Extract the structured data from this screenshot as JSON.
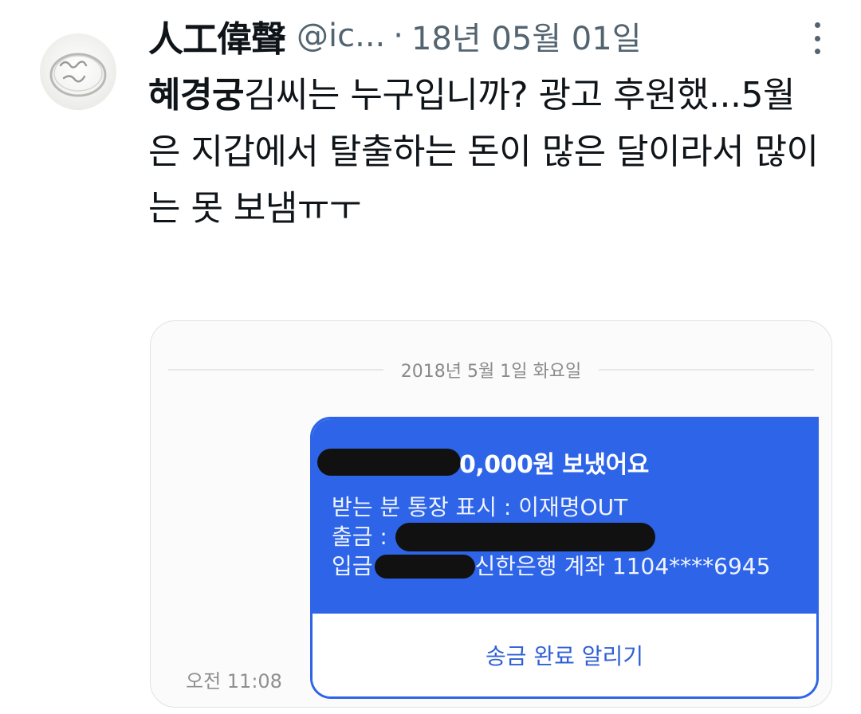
{
  "tweet": {
    "display_name": "人工偉聲",
    "handle": "@ic...",
    "separator": "·",
    "date": "18년 05월 01일",
    "text_bold": "혜경궁",
    "text_rest": "김씨는 누구입니까? 광고 후원했...5월은 지갑에서 탈출하는 돈이 많은 달이라서 많이는 못 보냄ㅠㅜ"
  },
  "chat": {
    "date_separator": "2018년 5월 1일 화요일",
    "time": "오전 11:08",
    "amount": "0,000원 보냈어요",
    "recipient_line": "받는 분 통장 표시 : 이재명OUT",
    "withdraw_label": "출금 :",
    "deposit_label": "입금",
    "deposit_account": "신한은행 계좌 1104****6945",
    "action_button": "송금 완료 알리기"
  },
  "colors": {
    "bubble_blue": "#2d64e8",
    "muted_gray": "#536471",
    "redaction": "#111111"
  }
}
